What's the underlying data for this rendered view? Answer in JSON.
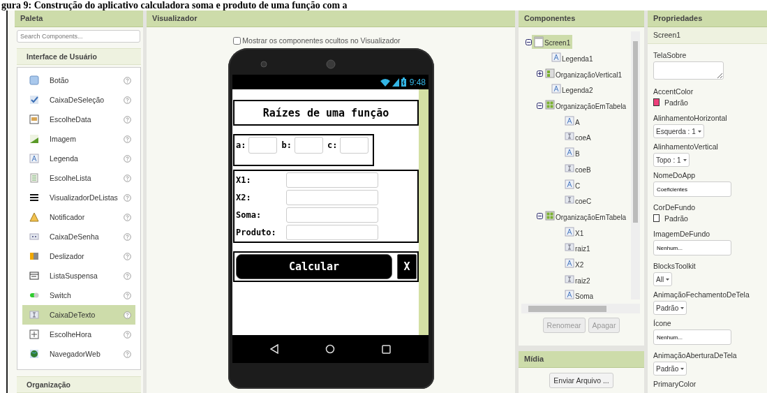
{
  "caption": "gura 9: Construção do aplicativo calculadora soma e produto de uma função com a",
  "palette": {
    "title": "Paleta",
    "search_placeholder": "Search Components...",
    "sections": [
      {
        "title": "Interface de Usuário",
        "expanded": true,
        "items": [
          {
            "label": "Botão",
            "kind": "button",
            "selected": false
          },
          {
            "label": "CaixaDeSeleção",
            "kind": "checkbox",
            "selected": false
          },
          {
            "label": "EscolheData",
            "kind": "datepicker",
            "selected": false
          },
          {
            "label": "Imagem",
            "kind": "image",
            "selected": false
          },
          {
            "label": "Legenda",
            "kind": "label",
            "selected": false
          },
          {
            "label": "EscolheLista",
            "kind": "listpicker",
            "selected": false
          },
          {
            "label": "VisualizadorDeListas",
            "kind": "listview",
            "selected": false
          },
          {
            "label": "Notificador",
            "kind": "notifier",
            "selected": false
          },
          {
            "label": "CaixaDeSenha",
            "kind": "password",
            "selected": false
          },
          {
            "label": "Deslizador",
            "kind": "slider",
            "selected": false
          },
          {
            "label": "ListaSuspensa",
            "kind": "spinner",
            "selected": false
          },
          {
            "label": "Switch",
            "kind": "switch",
            "selected": false
          },
          {
            "label": "CaixaDeTexto",
            "kind": "textbox",
            "selected": true
          },
          {
            "label": "EscolheHora",
            "kind": "timepicker",
            "selected": false
          },
          {
            "label": "NavegadorWeb",
            "kind": "webviewer",
            "selected": false
          }
        ]
      },
      {
        "title": "Organização",
        "expanded": false
      }
    ]
  },
  "viewer": {
    "title": "Visualizador",
    "hidden_checkbox": {
      "label": "Mostrar os componentes ocultos no Visualizador",
      "checked": false
    },
    "phone": {
      "time": "9:48",
      "title": "Raízes de uma função",
      "coefficients": [
        "a:",
        "b:",
        "c:"
      ],
      "results": [
        "X1:",
        "X2:",
        "Soma:",
        "Produto:"
      ],
      "buttons": [
        "Calcular",
        "X"
      ]
    }
  },
  "components": {
    "title": "Componentes",
    "tree": [
      {
        "label": "Screen1",
        "kind": "screen",
        "selected": true,
        "expanded": true,
        "children": [
          {
            "label": "Legenda1",
            "kind": "label",
            "selected": false
          },
          {
            "label": "OrganizaçãoVertical1",
            "kind": "vertical",
            "selected": false,
            "expanded": false
          },
          {
            "label": "Legenda2",
            "kind": "label",
            "selected": false
          },
          {
            "label": "OrganizaçãoEmTabela",
            "kind": "table",
            "selected": false,
            "expanded": true,
            "children": [
              {
                "label": "A",
                "kind": "label",
                "selected": false
              },
              {
                "label": "coeA",
                "kind": "textbox",
                "selected": false
              },
              {
                "label": "B",
                "kind": "label",
                "selected": false
              },
              {
                "label": "coeB",
                "kind": "textbox",
                "selected": false
              },
              {
                "label": "C",
                "kind": "label",
                "selected": false
              },
              {
                "label": "coeC",
                "kind": "textbox",
                "selected": false
              }
            ]
          },
          {
            "label": "OrganizaçãoEmTabela",
            "kind": "table",
            "selected": false,
            "expanded": true,
            "children": [
              {
                "label": "X1",
                "kind": "label",
                "selected": false
              },
              {
                "label": "raiz1",
                "kind": "textbox",
                "selected": false
              },
              {
                "label": "X2",
                "kind": "label",
                "selected": false
              },
              {
                "label": "raiz2",
                "kind": "textbox",
                "selected": false
              },
              {
                "label": "Soma",
                "kind": "label",
                "selected": false
              }
            ]
          }
        ]
      }
    ],
    "buttons": [
      {
        "label": "Renomear",
        "disabled": true
      },
      {
        "label": "Apagar",
        "disabled": true
      }
    ]
  },
  "media": {
    "title": "Mídia",
    "button": "Enviar Arquivo ..."
  },
  "properties": {
    "title": "Propriedades",
    "component": "Screen1",
    "items": [
      {
        "label": "TelaSobre",
        "kind": "textarea"
      },
      {
        "label": "AccentColor",
        "kind": "color",
        "value": "Padrão",
        "color": "#ee3f7a"
      },
      {
        "label": "AlinhamentoHorizontal",
        "kind": "dropdown",
        "value": "Esquerda : 1"
      },
      {
        "label": "AlinhamentoVertical",
        "kind": "dropdown",
        "value": "Topo : 1"
      },
      {
        "label": "NomeDoApp",
        "kind": "text",
        "value": "Coeficientes"
      },
      {
        "label": "CorDeFundo",
        "kind": "color",
        "value": "Padrão",
        "color": "#ffffff"
      },
      {
        "label": "ImagemDeFundo",
        "kind": "asset",
        "value": "Nenhum..."
      },
      {
        "label": "BlocksToolkit",
        "kind": "dropdown",
        "value": "All"
      },
      {
        "label": "AnimaçãoFechamentoDeTela",
        "kind": "dropdown",
        "value": "Padrão"
      },
      {
        "label": "Ícone",
        "kind": "asset",
        "value": "Nenhum..."
      },
      {
        "label": "AnimaçãoAberturaDeTela",
        "kind": "dropdown",
        "value": "Padrão"
      },
      {
        "label": "PrimaryColor"
      }
    ]
  }
}
